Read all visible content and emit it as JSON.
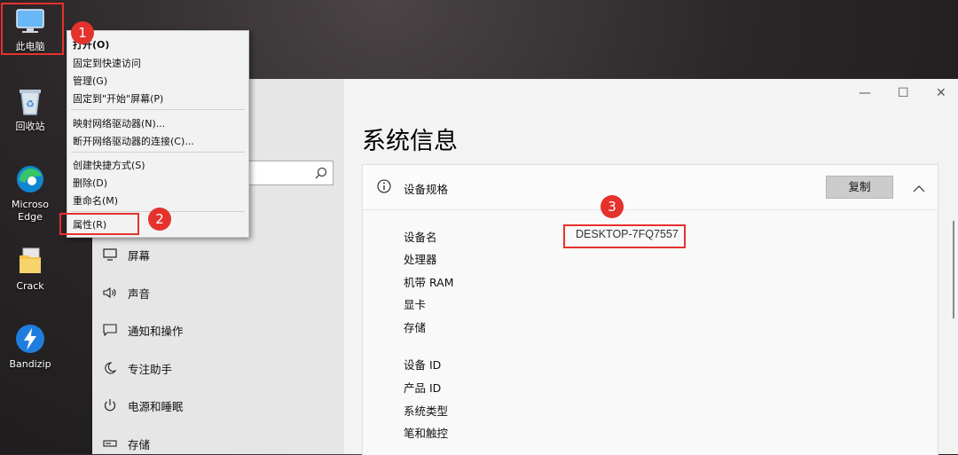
{
  "desktop": {
    "icons": [
      {
        "label": "此电脑"
      },
      {
        "label": "回收站"
      },
      {
        "label": "Microso\nEdge"
      },
      {
        "label": "Crack"
      },
      {
        "label": "Bandizip"
      }
    ]
  },
  "context_menu": {
    "items": [
      {
        "label": "打开(O)"
      },
      {
        "label": "固定到快速访问"
      },
      {
        "label": "管理(G)"
      },
      {
        "label": "固定到\"开始\"屏幕(P)"
      },
      {
        "label": "映射网络驱动器(N)..."
      },
      {
        "label": "断开网络驱动器的连接(C)..."
      },
      {
        "label": "创建快捷方式(S)"
      },
      {
        "label": "删除(D)"
      },
      {
        "label": "重命名(M)"
      },
      {
        "label": "属性(R)"
      }
    ]
  },
  "settings": {
    "sidebar": {
      "items": [
        {
          "label": "屏幕",
          "icon": "monitor-icon"
        },
        {
          "label": "声音",
          "icon": "speaker-icon"
        },
        {
          "label": "通知和操作",
          "icon": "notification-icon"
        },
        {
          "label": "专注助手",
          "icon": "moon-icon"
        },
        {
          "label": "电源和睡眠",
          "icon": "power-icon"
        },
        {
          "label": "存储",
          "icon": "storage-icon"
        }
      ]
    },
    "main": {
      "title": "系统信息",
      "section_title": "设备规格",
      "copy_label": "复制",
      "specs": [
        {
          "label": "设备名",
          "value": "DESKTOP-7FQ7557"
        },
        {
          "label": "处理器",
          "value": ""
        },
        {
          "label": "机带 RAM",
          "value": ""
        },
        {
          "label": "显卡",
          "value": ""
        },
        {
          "label": "存储",
          "value": ""
        },
        {
          "label": "设备 ID",
          "value": ""
        },
        {
          "label": "产品 ID",
          "value": ""
        },
        {
          "label": "系统类型",
          "value": ""
        },
        {
          "label": "笔和触控",
          "value": ""
        }
      ]
    }
  },
  "annotations": {
    "markers": [
      "1",
      "2",
      "3"
    ]
  },
  "colors": {
    "annotation_red": "#e5322d",
    "sidebar_bg": "#e6e6e6",
    "main_bg": "#f3f3f3"
  }
}
